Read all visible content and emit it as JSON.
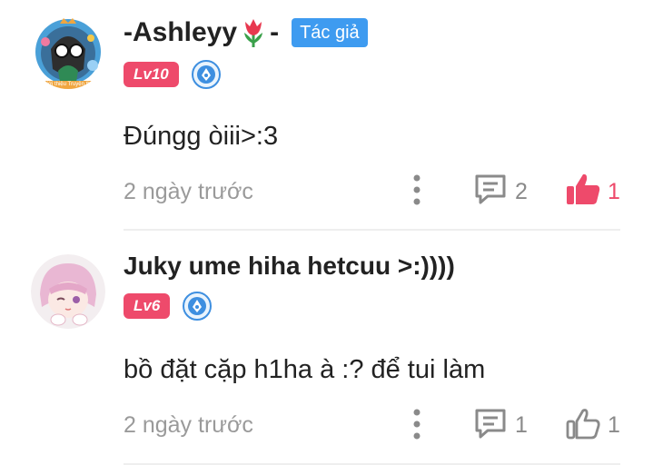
{
  "comments": [
    {
      "author": "-Ashleyy",
      "author_suffix": "-",
      "author_emoji": "tulip",
      "author_badge": "Tác giả",
      "level": "Lv10",
      "text": "Đúngg òiii>:3",
      "time": "2 ngày trước",
      "reply_count": "2",
      "like_count": "1",
      "liked": true,
      "avatar_banner": "Giới thiệu Truyện thể"
    },
    {
      "author": "Juky ume hiha hetcuu >:))))",
      "level": "Lv6",
      "text": "bồ đặt cặp h1ha à :? để tui làm",
      "time": "2 ngày trước",
      "reply_count": "1",
      "like_count": "1",
      "liked": false
    }
  ],
  "colors": {
    "author_badge": "#3e9bf0",
    "level_badge": "#ee4a6b",
    "like_active": "#ee4a6b",
    "icon_gray": "#8a8a8a",
    "level_icon": "#3e8fe0"
  }
}
